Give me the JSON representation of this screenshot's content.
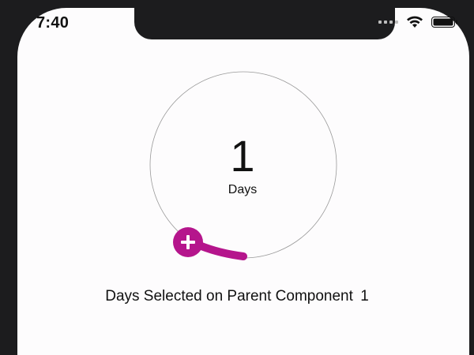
{
  "status_bar": {
    "time": "7:40",
    "icons": [
      "signal-icon",
      "wifi-icon",
      "battery-icon"
    ]
  },
  "dial": {
    "value": "1",
    "unit": "Days",
    "handle_icon": "plus-icon",
    "accent_color": "#b5158c",
    "track_color": "#9a9a9a"
  },
  "summary": {
    "label": "Days Selected on Parent Component",
    "value": "1"
  }
}
